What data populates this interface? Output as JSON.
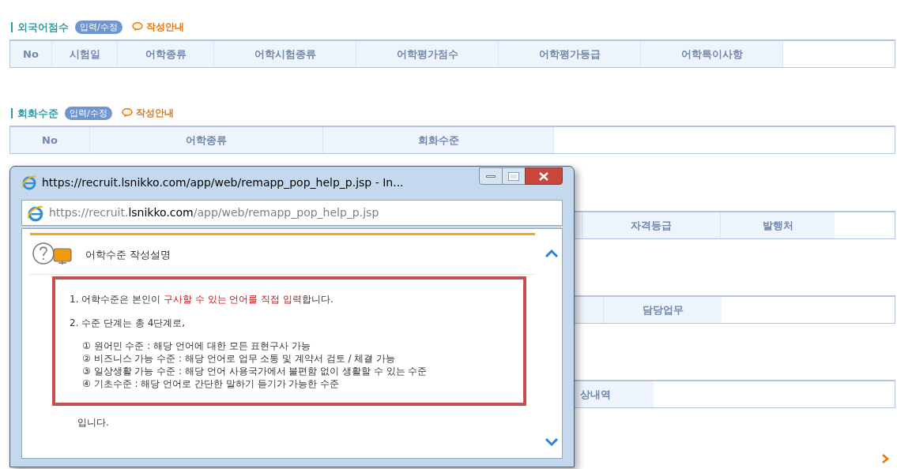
{
  "sections": [
    {
      "title": "외국어점수",
      "edit_button": "입력/수정",
      "guide_link": "작성안내",
      "columns": [
        "No",
        "시험일",
        "어학종류",
        "어학시험종류",
        "어학평가점수",
        "어학평가등급",
        "어학특이사항"
      ]
    },
    {
      "title": "회화수준",
      "edit_button": "입력/수정",
      "guide_link": "작성안내",
      "columns": [
        "No",
        "어학종류",
        "회화수준"
      ]
    }
  ],
  "obscured_tables": [
    {
      "columns": [
        "자격등급",
        "발행처"
      ]
    },
    {
      "columns": [
        "담당업무"
      ]
    },
    {
      "columns": [
        "상내역"
      ]
    }
  ],
  "popup": {
    "title": "https://recruit.lsnikko.com/app/web/remapp_pop_help_p.jsp - In...",
    "address": {
      "prefix": "https://recruit.",
      "domain": "lsnikko.com",
      "path": "/app/web/remapp_pop_help_p.jsp"
    },
    "heading": "어학수준 작성설명",
    "lines": [
      {
        "kind": "numbered",
        "text": "1. 어학수준은 본인이 **구사할 수 있는 언어를 직접 입력**합니다."
      },
      {
        "kind": "numbered",
        "text": "2. 수준 단계는 총 4단계로,"
      },
      {
        "kind": "sub",
        "text": "① 원어민 수준 : 해당 언어에 대한 모든 표현구사 가능"
      },
      {
        "kind": "sub",
        "text": "② 비즈니스 가능 수준 : 해당 언어로 업무 소통 및 계약서 검토 / 체결 가능"
      },
      {
        "kind": "sub",
        "text": "③ 일상생활 가능 수준 : 해당 언어 사용국가에서 불편함 없이 생활할 수 있는 수준"
      },
      {
        "kind": "sub",
        "text": "④ 기초수준 : 해당 언어로 간단한 말하기 듣기가 가능한 수준"
      }
    ],
    "footer": "입니다."
  }
}
